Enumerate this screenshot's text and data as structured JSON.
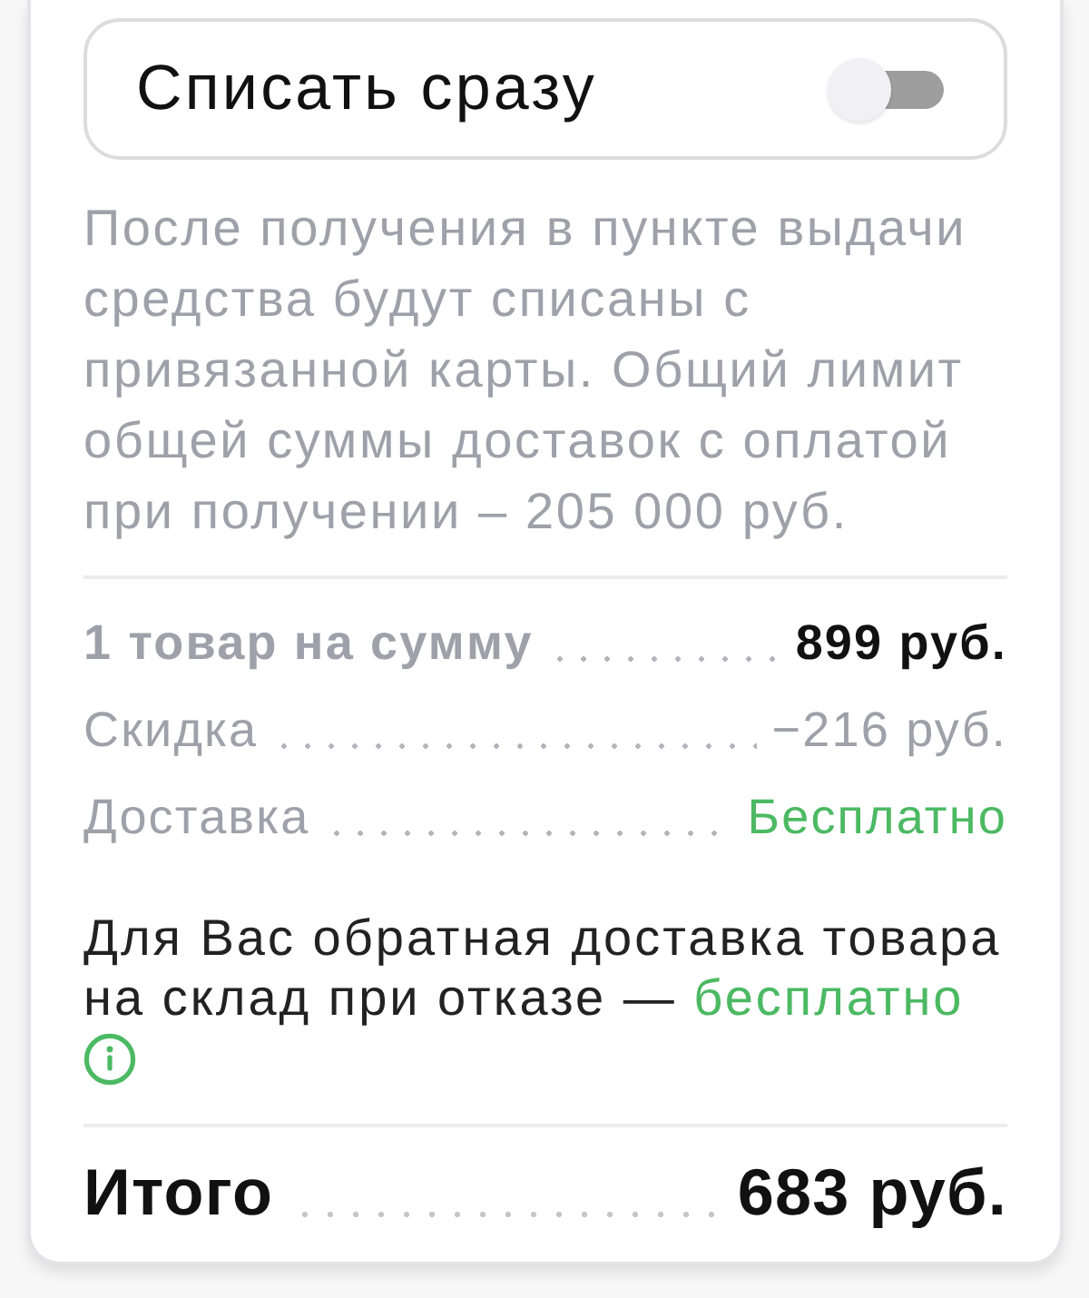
{
  "toggle": {
    "label": "Списать сразу",
    "on": false
  },
  "note": "После получения в пункте выдачи средства будут списаны с привязанной карты. Общий лимит общей суммы доставок с оплатой при получении – 205 000 руб.",
  "summary_rows": [
    {
      "kind": "subtotal",
      "label": "1 товар на сумму",
      "value": "899 руб."
    },
    {
      "kind": "discount",
      "label": "Скидка",
      "value": "−216 руб."
    },
    {
      "kind": "delivery",
      "label": "Доставка",
      "value": "Бесплатно"
    }
  ],
  "return_note": {
    "text": "Для Вас обратная доставка товара на склад при отказе — ",
    "highlight": "бесплатно"
  },
  "total": {
    "label": "Итого",
    "value": "683 руб."
  }
}
